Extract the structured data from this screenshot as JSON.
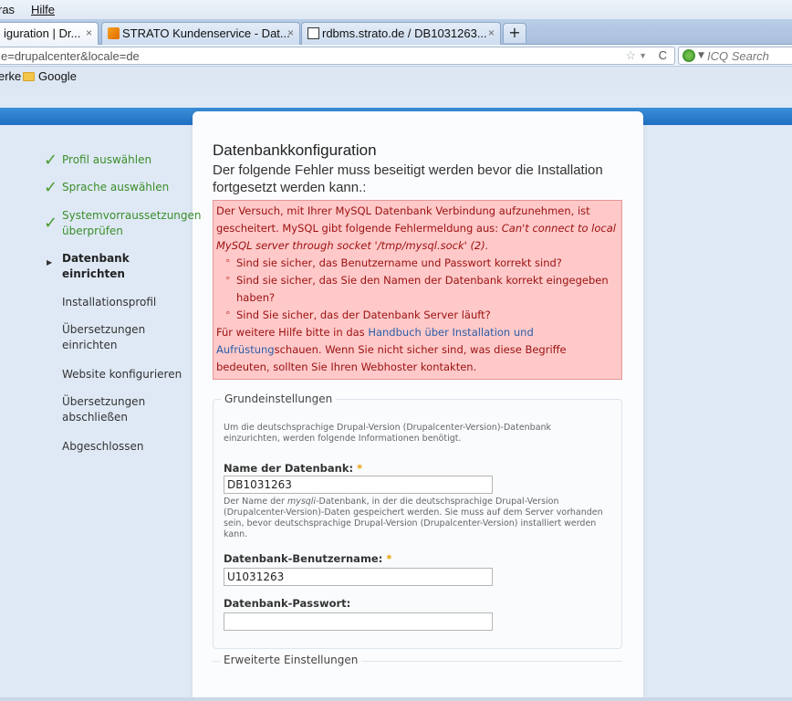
{
  "browser": {
    "menu": [
      "ras",
      "Hilfe"
    ],
    "tabs": [
      {
        "label": "iguration | Dr...",
        "close": "×"
      },
      {
        "label": "STRATO Kundenservice - Dat...",
        "close": "×"
      },
      {
        "label": "rdbms.strato.de / DB1031263...",
        "close": "×"
      }
    ],
    "new_tab": "+",
    "url": "e=drupalcenter&locale=de",
    "search_placeholder": "ICQ Search",
    "bookmarks": [
      "erke",
      "Google"
    ]
  },
  "sidebar": {
    "steps": [
      {
        "label": "Profil auswählen",
        "state": "done"
      },
      {
        "label": "Sprache auswählen",
        "state": "done"
      },
      {
        "label": "Systemvorraussetzungen überprüfen",
        "state": "done"
      },
      {
        "label": "Datenbank einrichten",
        "state": "active"
      },
      {
        "label": "Installationsprofil",
        "state": "pending"
      },
      {
        "label": "Übersetzungen einrichten",
        "state": "pending"
      },
      {
        "label": "Website konfigurieren",
        "state": "pending"
      },
      {
        "label": "Übersetzungen abschließen",
        "state": "pending"
      },
      {
        "label": "Abgeschlossen",
        "state": "pending"
      }
    ]
  },
  "main": {
    "title": "Datenbankkonfiguration",
    "subtitle": "Der folgende Fehler muss beseitigt werden bevor die Installation fortgesetzt werden kann.:"
  },
  "error": {
    "intro": "Der Versuch, mit Ihrer MySQL Datenbank Verbindung aufzunehmen, ist gescheitert. MySQL gibt folgende Fehlermeldung aus: ",
    "mysql_message": "Can't connect to local MySQL server through socket '/tmp/mysql.sock' (2).",
    "items": [
      "Sind sie sicher, das Benutzername und Passwort korrekt sind?",
      "Sind sie sicher, das Sie den Namen der Datenbank korrekt eingegeben haben?",
      "Sind Sie sicher, das der Datenbank Server läuft?"
    ],
    "help_prefix": "Für weitere Hilfe bitte in das ",
    "help_link": "Handbuch über Installation und Aufrüstung",
    "help_suffix": "schauen. Wenn Sie nicht sicher sind, was diese Begriffe bedeuten, sollten Sie Ihren Webhoster kontakten."
  },
  "form": {
    "legend": "Grundeinstellungen",
    "description": "Um die deutschsprachige Drupal-Version (Drupalcenter-Version)-Datenbank einzurichten, werden folgende Informationen benötigt.",
    "db_name": {
      "label": "Name der Datenbank:",
      "required": "*",
      "value": "DB1031263",
      "help_prefix": "Der Name der ",
      "help_em": "mysqli",
      "help_suffix": "-Datenbank, in der die deutschsprachige Drupal-Version (Drupalcenter-Version)-Daten gespeichert werden. Sie muss auf dem Server vorhanden sein, bevor deutschsprachige Drupal-Version (Drupalcenter-Version) installiert werden kann."
    },
    "db_user": {
      "label": "Datenbank-Benutzername:",
      "required": "*",
      "value": "U1031263"
    },
    "db_pass": {
      "label": "Datenbank-Passwort:",
      "value": ""
    },
    "advanced_legend": "Erweiterte Einstellungen"
  }
}
